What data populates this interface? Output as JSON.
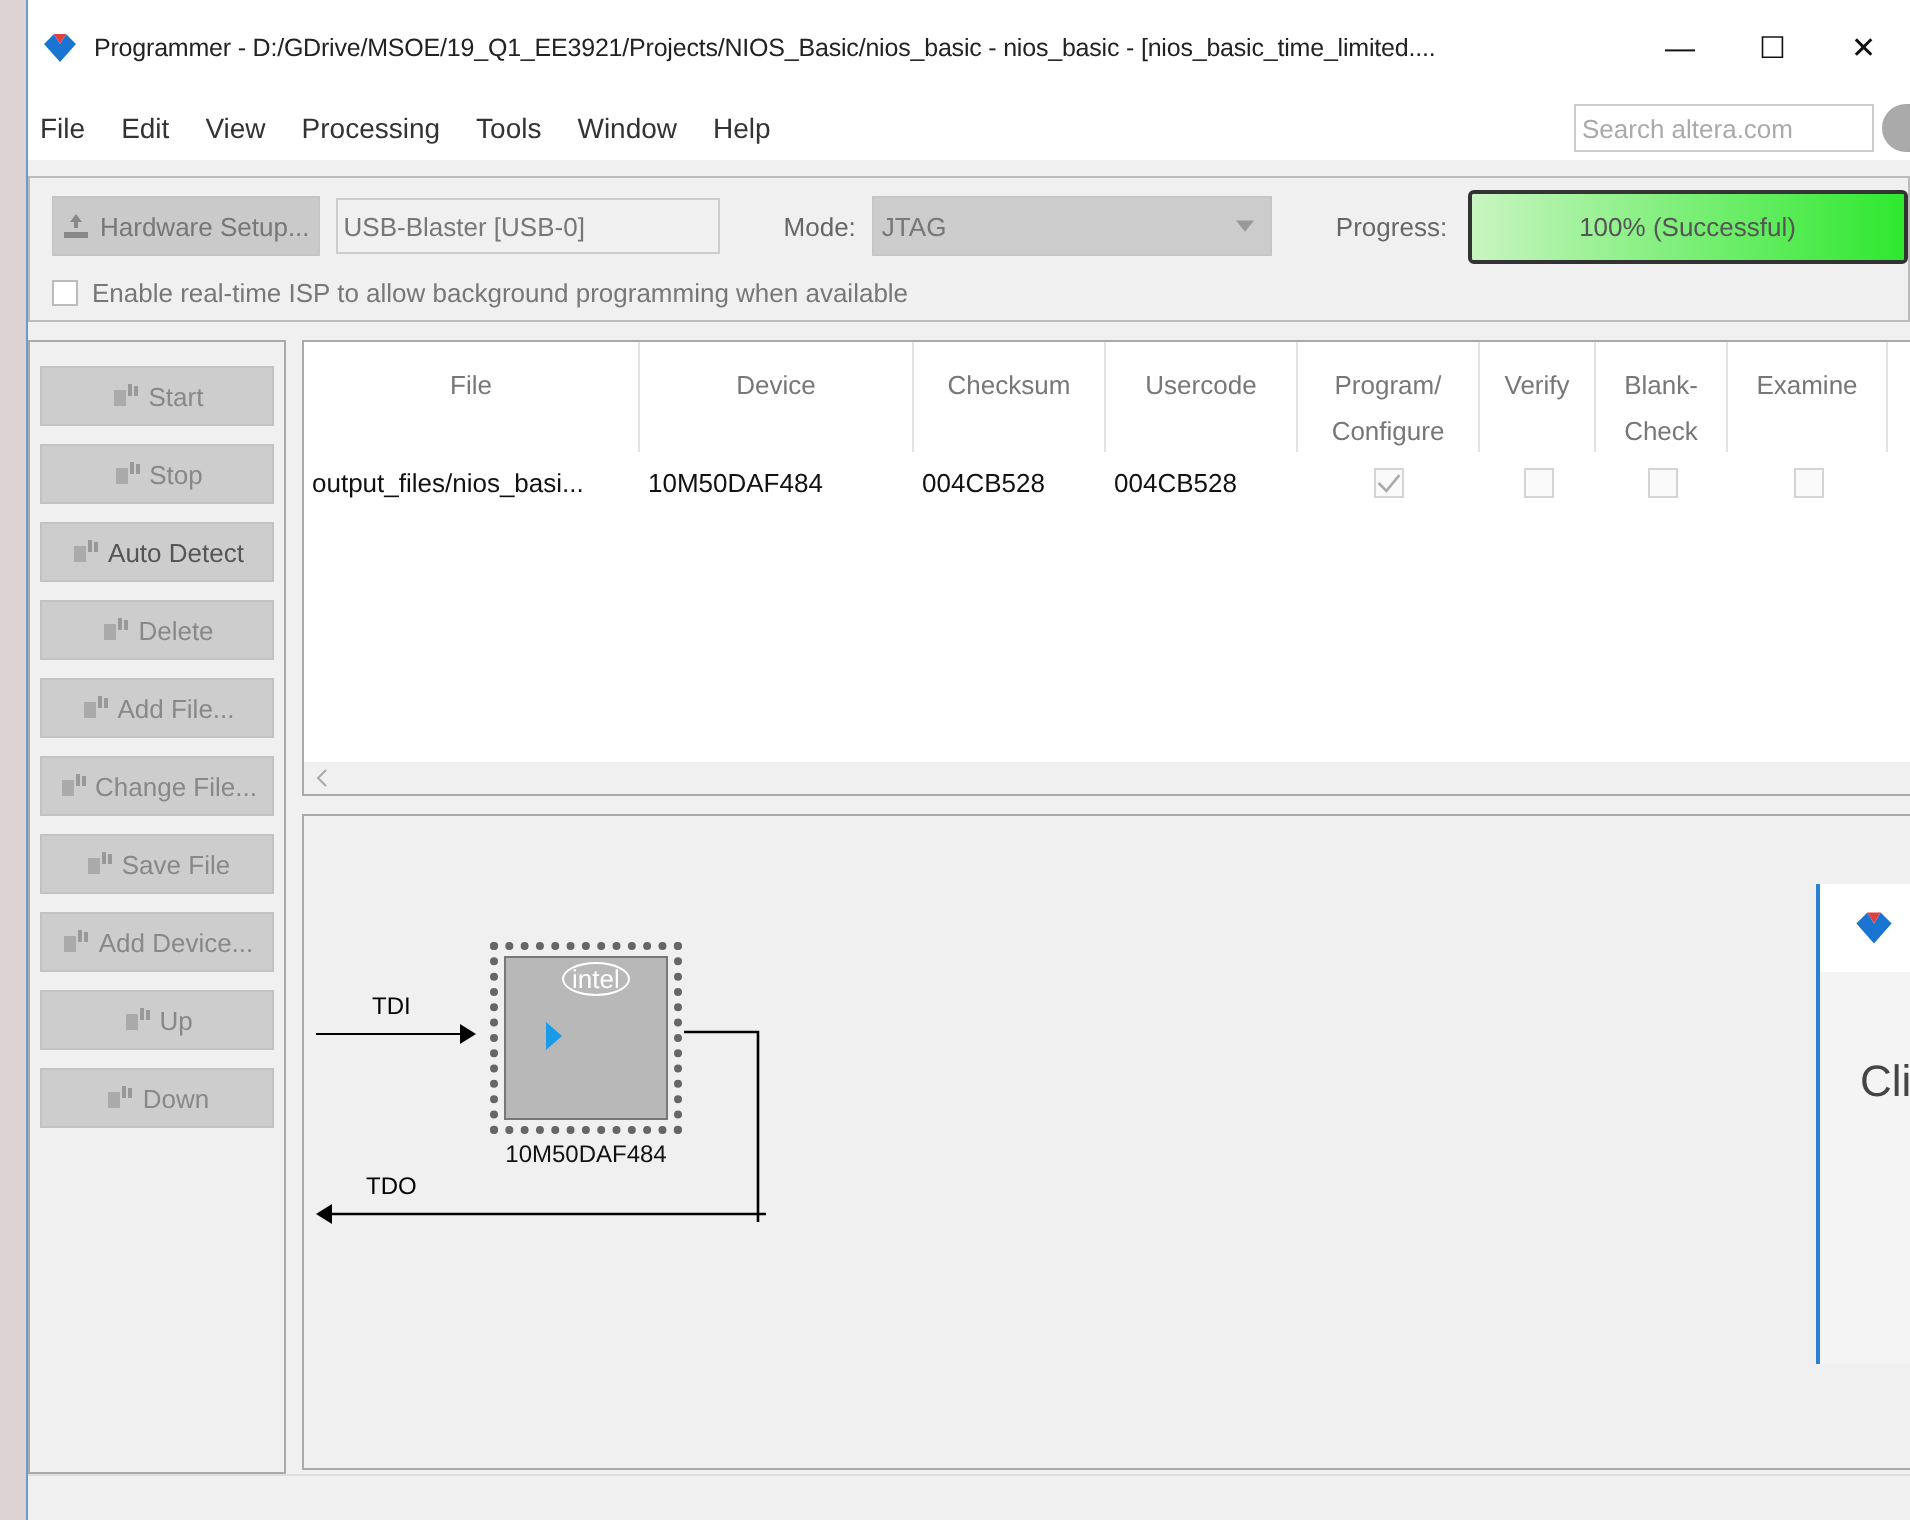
{
  "window": {
    "title": "Programmer - D:/GDrive/MSOE/19_Q1_EE3921/Projects/NIOS_Basic/nios_basic - nios_basic - [nios_basic_time_limited....",
    "controls": [
      "—",
      "☐",
      "✕"
    ]
  },
  "menu": [
    {
      "label": "File"
    },
    {
      "label": "Edit"
    },
    {
      "label": "View"
    },
    {
      "label": "Processing"
    },
    {
      "label": "Tools"
    },
    {
      "label": "Window"
    },
    {
      "label": "Help"
    }
  ],
  "search": {
    "placeholder": "Search altera.com"
  },
  "toolbar": {
    "hardware_button": "Hardware Setup...",
    "hardware_value": "USB-Blaster [USB-0]",
    "mode_label": "Mode:",
    "mode_value": "JTAG",
    "progress_label": "Progress:",
    "progress_text": "100% (Successful)",
    "level": 1,
    "isp": {
      "label": "Enable real-time ISP to allow background programming when available",
      "checked": false
    }
  },
  "buttons": [
    {
      "label": "Start",
      "disabled": true
    },
    {
      "label": "Stop",
      "disabled": true
    },
    {
      "label": "Auto Detect",
      "disabled": false
    },
    {
      "label": "Delete",
      "disabled": true
    },
    {
      "label": "Add File...",
      "disabled": true
    },
    {
      "label": "Change File...",
      "disabled": true
    },
    {
      "label": "Save File",
      "disabled": true
    },
    {
      "label": "Add Device...",
      "disabled": true
    },
    {
      "label": "Up",
      "disabled": true
    },
    {
      "label": "Down",
      "disabled": true
    }
  ],
  "table": {
    "columns": [
      "File",
      "Device",
      "Checksum",
      "Usercode",
      "Program/ Configure",
      "Verify",
      "Blank- Check",
      "Examine"
    ],
    "rows": [
      {
        "file": "output_files/nios_basi...",
        "device": "10M50DAF484",
        "checksum": "004CB528",
        "usercode": "004CB528",
        "checks": [
          {
            "checked": true,
            "disabled": true
          },
          {
            "checked": false,
            "disabled": true
          },
          {
            "checked": false,
            "disabled": true
          },
          {
            "checked": false,
            "disabled": true
          }
        ]
      }
    ]
  },
  "diagram": {
    "tdi": "TDI",
    "tdo": "TDO",
    "chip": {
      "logo": "intel",
      "label": "10M50DAF484"
    }
  },
  "overlay_window": {
    "text": "Cli"
  }
}
